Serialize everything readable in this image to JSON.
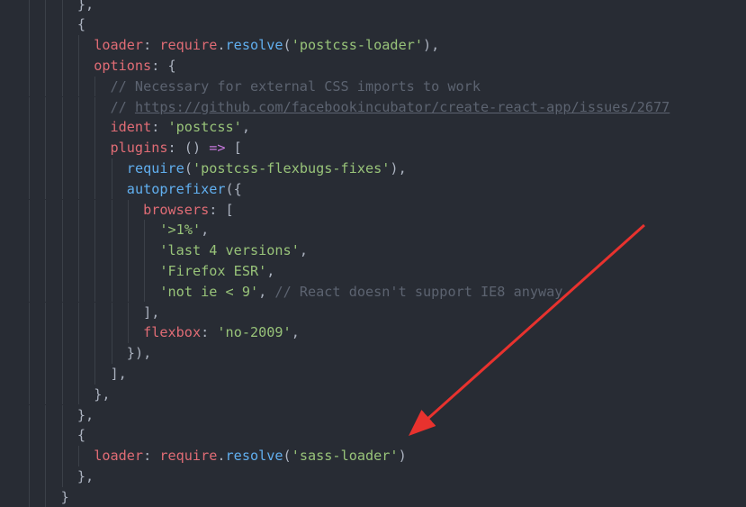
{
  "code_lines": [
    {
      "indent": 3,
      "tokens": [
        {
          "t": "},",
          "k": "punc"
        }
      ]
    },
    {
      "indent": 3,
      "tokens": [
        {
          "t": "{",
          "k": "punc"
        }
      ]
    },
    {
      "indent": 4,
      "tokens": [
        {
          "t": "loader",
          "k": "prop"
        },
        {
          "t": ": ",
          "k": "punc"
        },
        {
          "t": "require",
          "k": "prop"
        },
        {
          "t": ".",
          "k": "punc"
        },
        {
          "t": "resolve",
          "k": "fn"
        },
        {
          "t": "(",
          "k": "punc"
        },
        {
          "t": "'postcss-loader'",
          "k": "str"
        },
        {
          "t": "),",
          "k": "punc"
        }
      ]
    },
    {
      "indent": 4,
      "tokens": [
        {
          "t": "options",
          "k": "prop"
        },
        {
          "t": ": {",
          "k": "punc"
        }
      ]
    },
    {
      "indent": 5,
      "tokens": [
        {
          "t": "// Necessary for external CSS imports to work",
          "k": "com"
        }
      ]
    },
    {
      "indent": 5,
      "tokens": [
        {
          "t": "// ",
          "k": "com"
        },
        {
          "t": "https://github.com/facebookincubator/create-react-app/issues/2677",
          "k": "link"
        }
      ]
    },
    {
      "indent": 5,
      "tokens": [
        {
          "t": "ident",
          "k": "prop"
        },
        {
          "t": ": ",
          "k": "punc"
        },
        {
          "t": "'postcss'",
          "k": "str"
        },
        {
          "t": ",",
          "k": "punc"
        }
      ]
    },
    {
      "indent": 5,
      "tokens": [
        {
          "t": "plugins",
          "k": "prop"
        },
        {
          "t": ": () ",
          "k": "punc"
        },
        {
          "t": "=>",
          "k": "kw"
        },
        {
          "t": " [",
          "k": "punc"
        }
      ]
    },
    {
      "indent": 6,
      "tokens": [
        {
          "t": "require",
          "k": "fn"
        },
        {
          "t": "(",
          "k": "punc"
        },
        {
          "t": "'postcss-flexbugs-fixes'",
          "k": "str"
        },
        {
          "t": "),",
          "k": "punc"
        }
      ]
    },
    {
      "indent": 6,
      "tokens": [
        {
          "t": "autoprefixer",
          "k": "fn"
        },
        {
          "t": "({",
          "k": "punc"
        }
      ]
    },
    {
      "indent": 7,
      "tokens": [
        {
          "t": "browsers",
          "k": "prop"
        },
        {
          "t": ": [",
          "k": "punc"
        }
      ]
    },
    {
      "indent": 8,
      "tokens": [
        {
          "t": "'>1%'",
          "k": "str"
        },
        {
          "t": ",",
          "k": "punc"
        }
      ]
    },
    {
      "indent": 8,
      "tokens": [
        {
          "t": "'last 4 versions'",
          "k": "str"
        },
        {
          "t": ",",
          "k": "punc"
        }
      ]
    },
    {
      "indent": 8,
      "tokens": [
        {
          "t": "'Firefox ESR'",
          "k": "str"
        },
        {
          "t": ",",
          "k": "punc"
        }
      ]
    },
    {
      "indent": 8,
      "tokens": [
        {
          "t": "'not ie < 9'",
          "k": "str"
        },
        {
          "t": ", ",
          "k": "punc"
        },
        {
          "t": "// React doesn't support IE8 anyway",
          "k": "com"
        }
      ]
    },
    {
      "indent": 7,
      "tokens": [
        {
          "t": "],",
          "k": "punc"
        }
      ]
    },
    {
      "indent": 7,
      "tokens": [
        {
          "t": "flexbox",
          "k": "prop"
        },
        {
          "t": ": ",
          "k": "punc"
        },
        {
          "t": "'no-2009'",
          "k": "str"
        },
        {
          "t": ",",
          "k": "punc"
        }
      ]
    },
    {
      "indent": 6,
      "tokens": [
        {
          "t": "}),",
          "k": "punc"
        }
      ]
    },
    {
      "indent": 5,
      "tokens": [
        {
          "t": "],",
          "k": "punc"
        }
      ]
    },
    {
      "indent": 4,
      "tokens": [
        {
          "t": "},",
          "k": "punc"
        }
      ]
    },
    {
      "indent": 3,
      "tokens": [
        {
          "t": "},",
          "k": "punc"
        }
      ]
    },
    {
      "indent": 3,
      "tokens": [
        {
          "t": "{",
          "k": "punc"
        }
      ]
    },
    {
      "indent": 4,
      "tokens": [
        {
          "t": "loader",
          "k": "prop"
        },
        {
          "t": ": ",
          "k": "punc"
        },
        {
          "t": "require",
          "k": "prop"
        },
        {
          "t": ".",
          "k": "punc"
        },
        {
          "t": "resolve",
          "k": "fn"
        },
        {
          "t": "(",
          "k": "punc"
        },
        {
          "t": "'sass-loader'",
          "k": "str"
        },
        {
          "t": ")",
          "k": "punc"
        }
      ]
    },
    {
      "indent": 3,
      "tokens": [
        {
          "t": "},",
          "k": "punc"
        }
      ]
    },
    {
      "indent": 2,
      "tokens": [
        {
          "t": "}",
          "k": "punc"
        }
      ]
    }
  ],
  "annotation": {
    "arrow_color": "#e8322e",
    "points_to": "sass-loader line"
  },
  "theme": {
    "background": "#282c34",
    "property": "#e06c75",
    "function": "#61afef",
    "string": "#98c379",
    "keyword": "#c678dd",
    "comment": "#5c6370",
    "punctuation": "#abb2bf",
    "indent_guide": "#3b4048"
  }
}
